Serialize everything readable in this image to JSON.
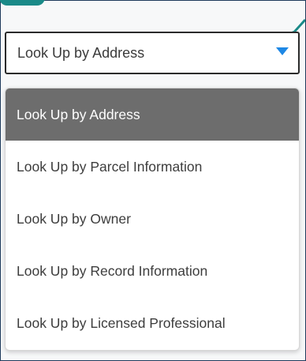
{
  "select": {
    "value": "Look Up by Address"
  },
  "menu": {
    "items": [
      {
        "label": "Look Up by Address",
        "selected": true
      },
      {
        "label": "Look Up by Parcel Information",
        "selected": false
      },
      {
        "label": "Look Up by Owner",
        "selected": false
      },
      {
        "label": "Look Up by Record Information",
        "selected": false
      },
      {
        "label": "Look Up by Licensed Professional",
        "selected": false
      }
    ]
  },
  "colors": {
    "accent": "#1a8a88",
    "caret": "#1e88e5",
    "selected_bg": "#6d6d6d"
  },
  "icons": {
    "caret": "caret-down-icon",
    "arrow": "pointer-arrow-icon"
  }
}
